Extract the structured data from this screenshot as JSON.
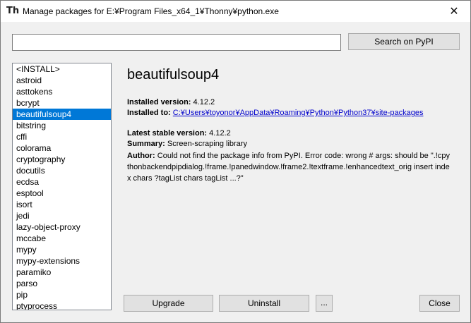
{
  "window": {
    "title": "Manage packages for E:¥Program Files_x64_1¥Thonny¥python.exe",
    "app_icon": "Th",
    "close_glyph": "✕"
  },
  "search": {
    "value": "",
    "button_label": "Search on PyPI"
  },
  "packages": {
    "items": [
      "<INSTALL>",
      "astroid",
      "asttokens",
      "bcrypt",
      "beautifulsoup4",
      "bitstring",
      "cffi",
      "colorama",
      "cryptography",
      "docutils",
      "ecdsa",
      "esptool",
      "isort",
      "jedi",
      "lazy-object-proxy",
      "mccabe",
      "mypy",
      "mypy-extensions",
      "paramiko",
      "parso",
      "pip",
      "ptyprocess"
    ],
    "selected": "beautifulsoup4"
  },
  "details": {
    "name": "beautifulsoup4",
    "installed_version_label": "Installed version:",
    "installed_version": "4.12.2",
    "installed_to_label": "Installed to:",
    "installed_to": "C:¥Users¥toyonor¥AppData¥Roaming¥Python¥Python37¥site-packages",
    "latest_label": "Latest stable version:",
    "latest_version": "4.12.2",
    "summary_label": "Summary:",
    "summary": "Screen-scraping library",
    "author_label": "Author:",
    "author": "Could not find the package info from PyPI. Error code: wrong # args: should be \".!cpythonbackendpipdialog.!frame.!panedwindow.!frame2.!textframe.!enhancedtext_orig insert index chars ?tagList chars tagList ...?\""
  },
  "buttons": {
    "upgrade": "Upgrade",
    "uninstall": "Uninstall",
    "more": "...",
    "close": "Close"
  },
  "colors": {
    "selection": "#0078d7",
    "link": "#0000cc"
  }
}
